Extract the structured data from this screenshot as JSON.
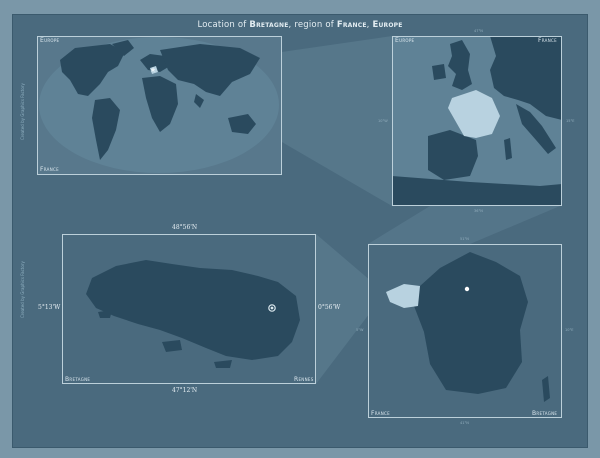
{
  "title": {
    "prefix": "Location of",
    "region": "Bretagne",
    "mid": ", region of",
    "country": "France",
    "sep": ",",
    "continent": "Europe"
  },
  "world_panel": {
    "label_top": "Europe",
    "label_bottom": "France"
  },
  "europe_panel": {
    "label_left": "Europe",
    "label_right": "France",
    "tick_top": "47°N",
    "tick_bottom": "36°N",
    "tick_left": "10°W",
    "tick_right": "15°E"
  },
  "region_panel": {
    "label_left": "Bretagne",
    "label_right": "Rennes",
    "lat_top": "48°56'N",
    "lat_bottom": "47°12'N",
    "lon_left": "5°13'W",
    "lon_right": "0°56'W"
  },
  "france_panel": {
    "label_left": "France",
    "label_right": "Bretagne",
    "tick_top": "51°N",
    "tick_bottom": "41°N",
    "tick_left": "5°W",
    "tick_right": "10°E"
  },
  "credits": {
    "left_top": "Created by Graphics Factory",
    "left_bottom": "Created by Graphics Factory"
  },
  "colors": {
    "background": "#4a6a7e",
    "land_dark": "#2a4a5e",
    "land_mid": "#3d5f73",
    "highlight": "#b8d2e0",
    "ocean": "#5f8296"
  }
}
